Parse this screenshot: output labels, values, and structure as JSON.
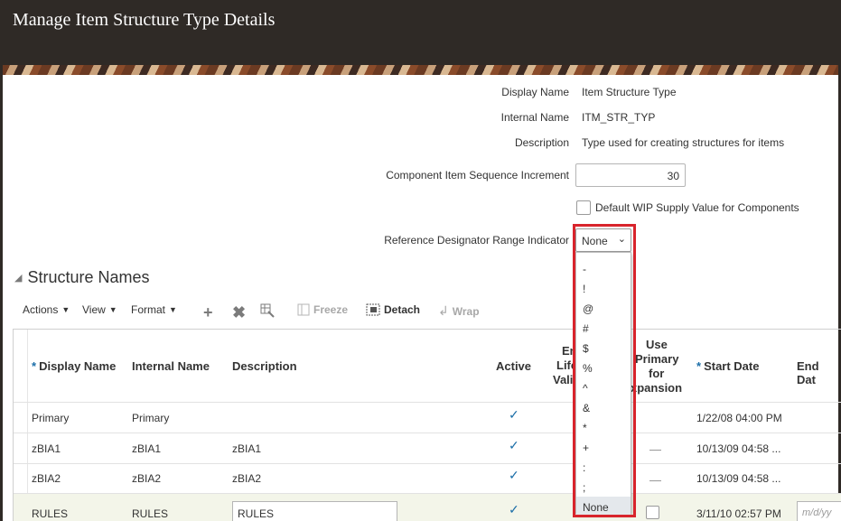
{
  "page": {
    "title": "Manage Item Structure Type Details"
  },
  "form": {
    "display_name_label": "Display Name",
    "display_name_value": "Item Structure Type",
    "internal_name_label": "Internal Name",
    "internal_name_value": "ITM_STR_TYP",
    "description_label": "Description",
    "description_value": "Type used for creating structures for items",
    "seq_increment_label": "Component Item Sequence Increment",
    "seq_increment_value": "30",
    "wip_checkbox_label": "Default WIP Supply Value for Components",
    "ref_designator_label": "Reference Designator Range Indicator",
    "ref_designator_value": "None"
  },
  "dropdown": {
    "options": [
      "-",
      "!",
      "@",
      "#",
      "$",
      "%",
      "^",
      "&",
      "*",
      "+",
      ":",
      ";",
      "None"
    ],
    "selected": "None"
  },
  "section": {
    "title": "Structure Names"
  },
  "toolbar": {
    "actions": "Actions",
    "view": "View",
    "format": "Format",
    "freeze": "Freeze",
    "detach": "Detach",
    "wrap": "Wrap"
  },
  "table": {
    "headers": {
      "display_name": "Display Name",
      "internal_name": "Internal Name",
      "description": "Description",
      "active": "Active",
      "lifecycle_l1": "En",
      "lifecycle_l2": "Life",
      "lifecycle_l3": "Vali",
      "use_primary_l1": "Use",
      "use_primary_l2": "Primary",
      "use_primary_l3": "for",
      "use_primary_l4": "xpansion",
      "start_date": "Start Date",
      "end_date": "End Dat"
    },
    "rows": [
      {
        "display_name": "Primary",
        "internal_name": "Primary",
        "description": "",
        "start_date": "1/22/08 04:00 PM"
      },
      {
        "display_name": "zBIA1",
        "internal_name": "zBIA1",
        "description": "zBIA1",
        "start_date": "10/13/09 04:58 ..."
      },
      {
        "display_name": "zBIA2",
        "internal_name": "zBIA2",
        "description": "zBIA2",
        "start_date": "10/13/09 04:58 ..."
      },
      {
        "display_name": "RULES",
        "internal_name": "RULES",
        "description": "RULES",
        "start_date": "3/11/10 02:57 PM",
        "end_date_placeholder": "m/d/yy"
      }
    ]
  },
  "colors": {
    "header_bg": "#2f2a26",
    "highlight": "#d8242c",
    "accent": "#1b6ea8"
  }
}
